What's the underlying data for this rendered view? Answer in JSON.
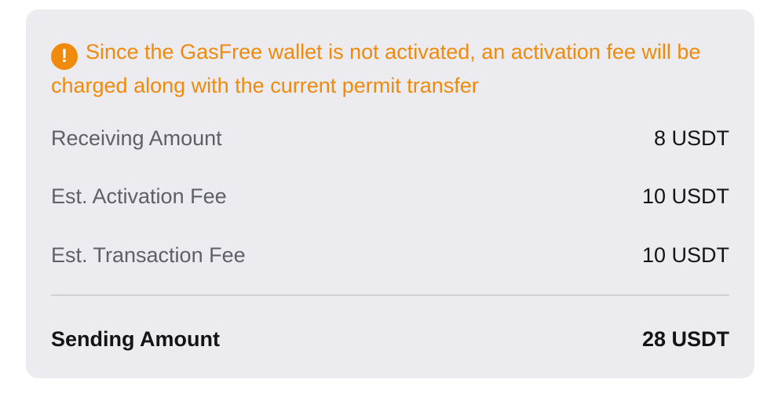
{
  "notice": {
    "icon": "exclamation-circle-icon",
    "icon_glyph": "!",
    "text": "Since the GasFree wallet is not activated, an activation fee will be charged along with the current permit transfer",
    "color": "#f08a0c"
  },
  "rows": [
    {
      "label": "Receiving Amount",
      "value": "8 USDT"
    },
    {
      "label": "Est. Activation Fee",
      "value": "10 USDT"
    },
    {
      "label": "Est. Transaction Fee",
      "value": "10 USDT"
    }
  ],
  "total": {
    "label": "Sending Amount",
    "value": "28 USDT"
  },
  "colors": {
    "card_background": "#ebebf0",
    "label": "#5f5f68",
    "value": "#141418"
  }
}
